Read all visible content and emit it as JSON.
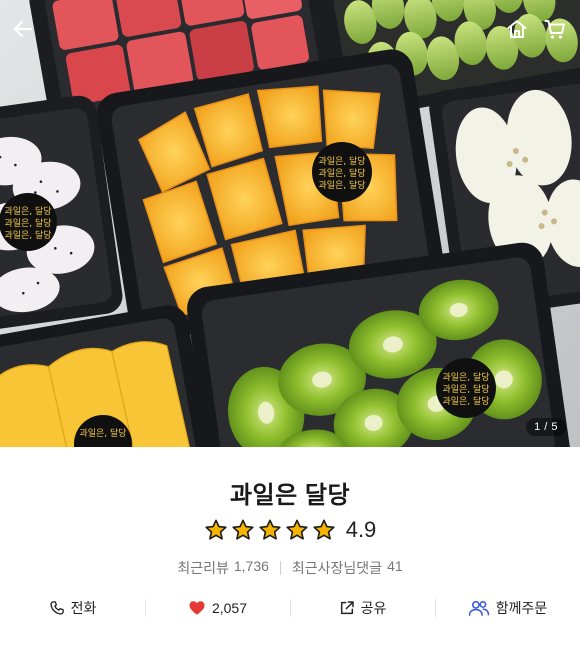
{
  "topbar": {
    "back_icon": "arrow-left-icon",
    "home_icon": "home-icon",
    "cart_icon": "cart-icon"
  },
  "gallery": {
    "counter": "1 / 5",
    "sticker_line1": "과일은, 달당",
    "sticker_line2": "과일은, 달당",
    "sticker_line3": "과일은, 달당"
  },
  "store": {
    "name": "과일은 달당",
    "rating": "4.9",
    "stars_filled": 5,
    "reviews_label": "최근리뷰",
    "reviews_count": "1,736",
    "owner_replies_label": "최근사장님댓글",
    "owner_replies_count": "41"
  },
  "actions": {
    "call_label": "전화",
    "like_count": "2,057",
    "share_label": "공유",
    "group_order_label": "함께주문"
  },
  "colors": {
    "star": "#f5b400",
    "heart": "#e53935",
    "group_icon": "#3b5bdb"
  }
}
